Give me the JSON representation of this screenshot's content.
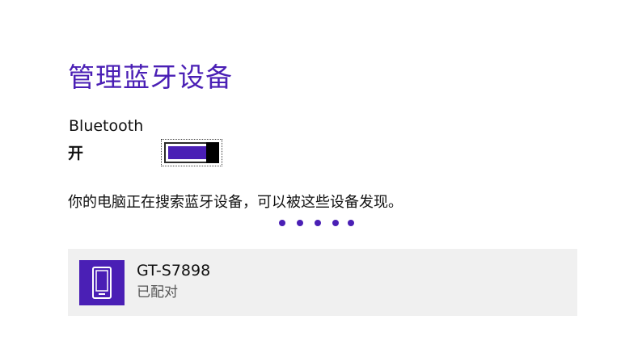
{
  "page": {
    "title": "管理蓝牙设备",
    "accent_color": "#4a1fb5"
  },
  "bluetooth": {
    "label": "Bluetooth",
    "state_label": "开",
    "enabled": true
  },
  "status": {
    "message": "你的电脑正在搜索蓝牙设备，可以被这些设备发现。",
    "progress_indicator": "searching-dots"
  },
  "devices": [
    {
      "name": "GT-S7898",
      "status": "已配对",
      "icon": "phone-icon"
    }
  ]
}
